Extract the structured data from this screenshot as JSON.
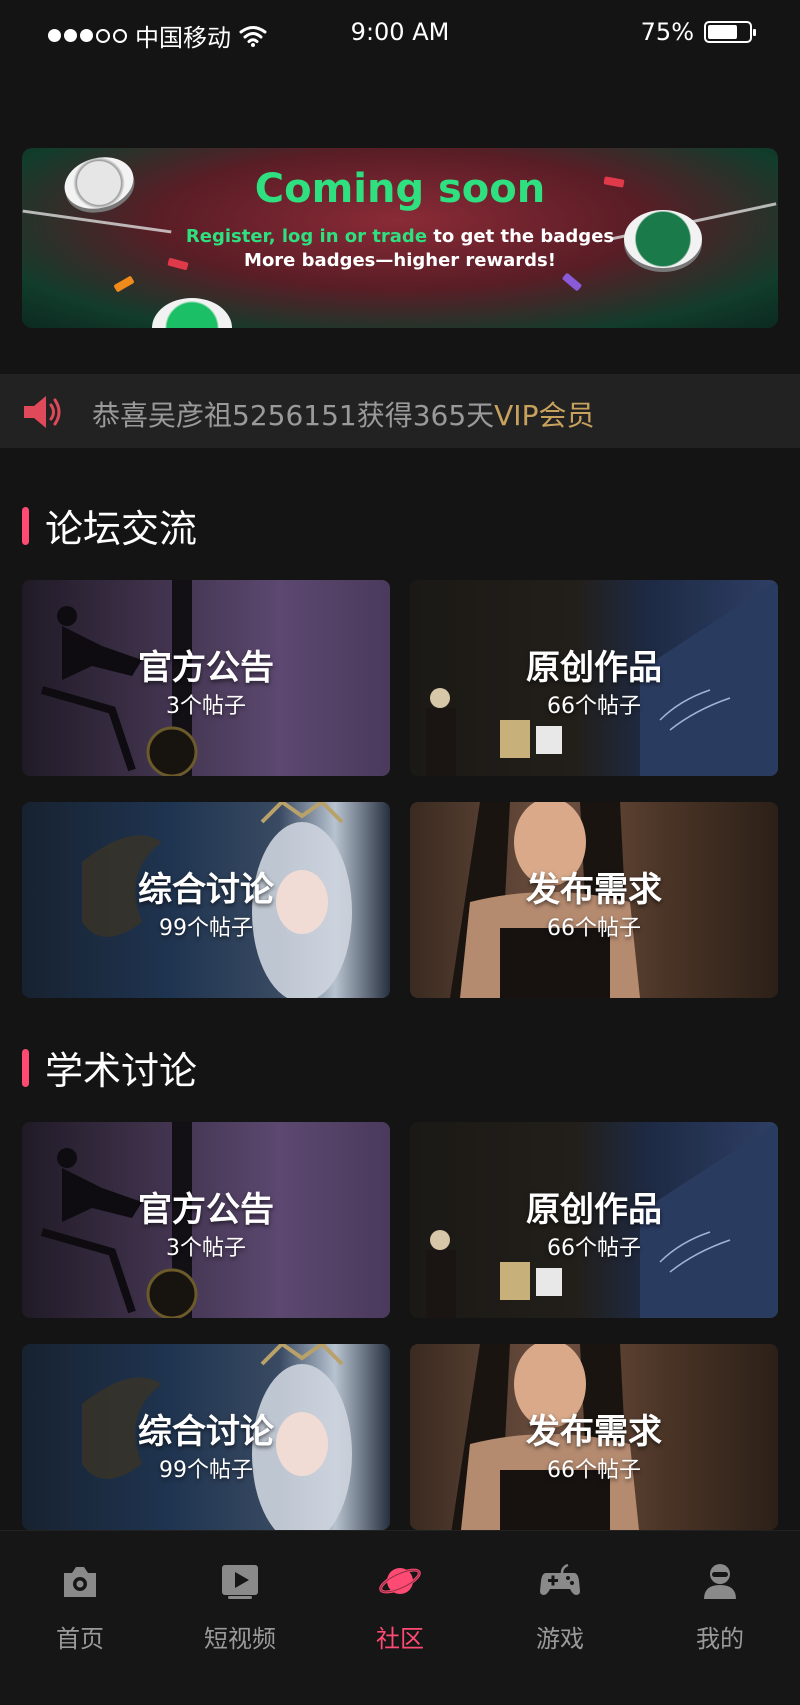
{
  "status_bar": {
    "carrier": "中国移动",
    "time": "9:00 AM",
    "battery": "75%",
    "battery_level": 0.75
  },
  "banner": {
    "title": "Coming soon",
    "line1_highlight": "Register, log in or trade",
    "line1_rest": " to get the badges",
    "line2": "More badges—higher rewards!"
  },
  "notice": {
    "text": "恭喜吴彦祖5256151获得365天",
    "vip": "VIP会员"
  },
  "sections": [
    {
      "title": "论坛交流",
      "cards": [
        {
          "name": "官方公告",
          "count": "3个帖子"
        },
        {
          "name": "原创作品",
          "count": "66个帖子"
        },
        {
          "name": "综合讨论",
          "count": "99个帖子"
        },
        {
          "name": "发布需求",
          "count": "66个帖子"
        }
      ]
    },
    {
      "title": "学术讨论",
      "cards": [
        {
          "name": "官方公告",
          "count": "3个帖子"
        },
        {
          "name": "原创作品",
          "count": "66个帖子"
        },
        {
          "name": "综合讨论",
          "count": "99个帖子"
        },
        {
          "name": "发布需求",
          "count": "66个帖子"
        }
      ]
    }
  ],
  "nav": {
    "items": [
      {
        "label": "首页",
        "icon": "home-camera-icon"
      },
      {
        "label": "短视频",
        "icon": "video-play-icon"
      },
      {
        "label": "社区",
        "icon": "planet-icon"
      },
      {
        "label": "游戏",
        "icon": "gamepad-icon"
      },
      {
        "label": "我的",
        "icon": "user-icon"
      }
    ],
    "active_index": 2
  },
  "colors": {
    "background": "#141414",
    "accent": "#ff4a73",
    "banner_green": "#2ee07f",
    "vip_gold": "#c8a25d",
    "inactive_text": "#9a9a9a"
  }
}
